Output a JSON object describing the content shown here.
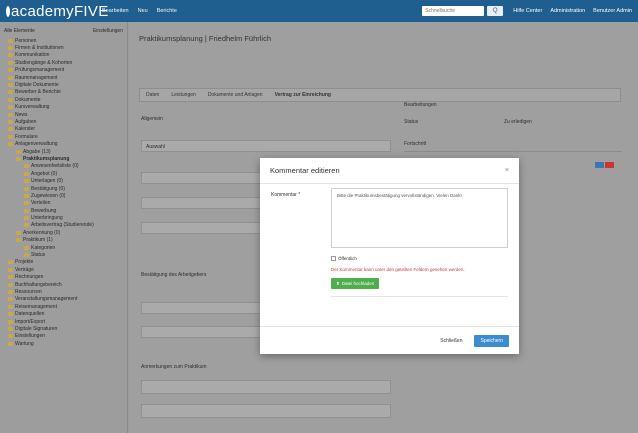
{
  "topbar": {
    "logo": "academyFIVE",
    "nav": [
      "Bearbeiten",
      "Neu",
      "Berichte"
    ],
    "search_placeholder": "Schnellsuche",
    "search_button": "Q",
    "right_items": [
      "Hilfe Center",
      "Administration",
      "Benutzer Admin"
    ]
  },
  "sidebar": {
    "header_left": "Alle Elemente",
    "header_right": "Einstellungen",
    "items": [
      "Personen",
      "Firmen & Institutionen",
      "Kommunikation",
      "Studiengänge & Kohorten",
      "Prüfungsmanagement",
      "Raummanagement",
      "Digitale Dokumente",
      "Bewerber & Berichte",
      "Dokumente",
      "Kursverwaltung",
      "News",
      "Aufgaben",
      "Kalender",
      "Formulare",
      "Anlagenverwaltung",
      "Abgabe (13)",
      "Praktikumsplanung",
      "Anwesenheitsliste (0)",
      "Angebot (0)",
      "Unterlagen (0)",
      "Bestätigung (0)",
      "Zugewiesen (0)",
      "Verteilen",
      "Bewerbung",
      "Unterbringung",
      "Arbeitsvertrag (Studierende)",
      "Anerkennung (0)",
      "Praktikum (1)",
      "Kategorien",
      "Status",
      "Projekte",
      "Verträge",
      "Rechnungen",
      "Buchhaltungsbereich",
      "Ressourcen",
      "Veranstaltungsmanagement",
      "Reisemanagement",
      "Datenquellen",
      "Import/Export",
      "Digitale Signaturen",
      "Einstellungen",
      "Wartung"
    ],
    "active_item": "Praktikumsplanung"
  },
  "main": {
    "page_title": "Praktikumsplanung | Friedhelm Führlich",
    "tabs": [
      "Daten",
      "Leistungen",
      "Dokumente und Anlagen",
      "Vertrag zur Einreichung"
    ],
    "labels": {
      "section": "Allgemein",
      "right_section": "Bearbeitungen",
      "right_status_label": "Status",
      "right_status_value": "Zu erledigen",
      "progress": "Fortschritt",
      "hint": "Bestätigung des Arbeitgebers",
      "select_default": "Auswahl",
      "extra": "Anmerkungen zum Praktikum"
    }
  },
  "modal": {
    "title": "Kommentar editieren",
    "close": "×",
    "field_label": "Kommentar *",
    "textarea_value": "Bitte die Praktikumsbestätigung vervollständigen. Vielen Dank!",
    "checkbox_label": "Öffentlich",
    "hint": "Der Kommentar kann unter den geteilten Feldern gesehen werden.",
    "upload_button": "Datei hochladen",
    "cancel_button": "Schließen",
    "save_button": "Speichern"
  },
  "colors": {
    "topbar": "#1f5f8f",
    "save": "#3c8dd0",
    "upload": "#4fae4c",
    "hint": "#d0392f",
    "badge_blue": "#3a76b8",
    "badge_red": "#c8362f"
  }
}
